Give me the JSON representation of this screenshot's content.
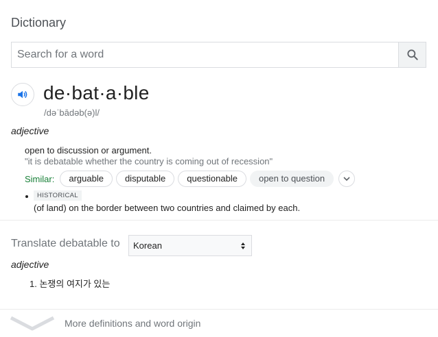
{
  "card": {
    "title": "Dictionary"
  },
  "search": {
    "placeholder": "Search for a word",
    "value": ""
  },
  "entry": {
    "headword": "de·bat·a·ble",
    "phonetic": "/dəˈbādəb(ə)l/",
    "part_of_speech": "adjective",
    "senses": [
      {
        "definition": "open to discussion or argument.",
        "example": "\"it is debatable whether the country is coming out of recession\"",
        "similar_label": "Similar:",
        "similar": [
          "arguable",
          "disputable",
          "questionable",
          "open to question"
        ]
      },
      {
        "tag": "HISTORICAL",
        "definition": "(of land) on the border between two countries and claimed by each."
      }
    ]
  },
  "translate": {
    "label": "Translate debatable to",
    "language": "Korean",
    "part_of_speech": "adjective",
    "items": [
      "1. 논쟁의 여지가 있는"
    ]
  },
  "footer": {
    "more_label": "More definitions and word origin"
  },
  "icons": {
    "search": "search-icon",
    "audio": "speaker-icon",
    "expand": "chevron-down-icon",
    "select": "up-down-arrows-icon",
    "more": "chevron-down-icon"
  },
  "colors": {
    "accent": "#1a73e8",
    "similar_label": "#188038",
    "muted": "#70757a"
  }
}
